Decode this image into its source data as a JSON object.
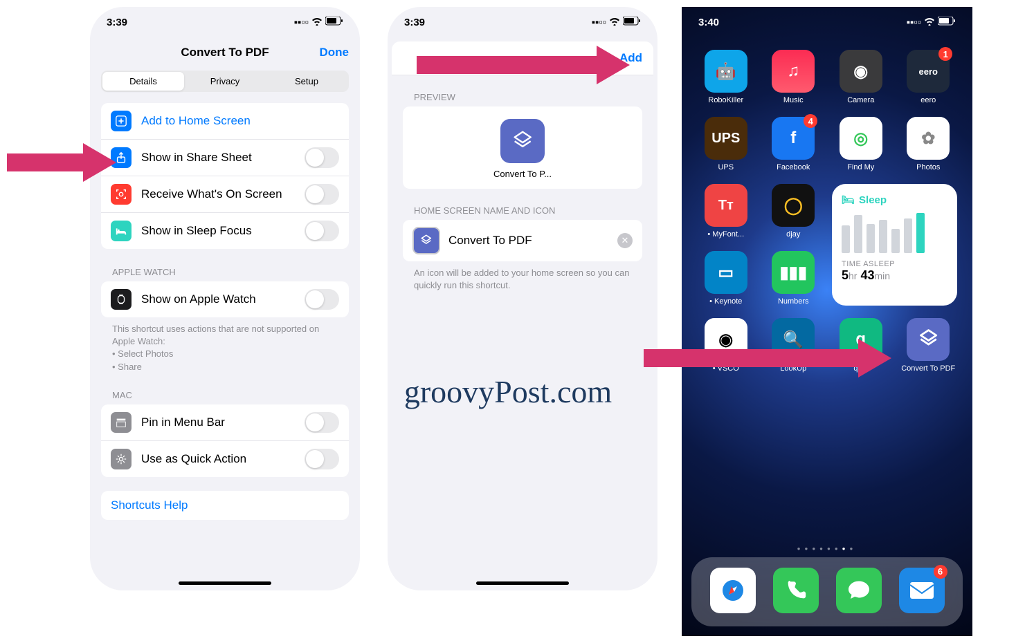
{
  "watermark": "groovyPost.com",
  "phone1": {
    "time": "3:39",
    "title": "Convert To PDF",
    "done": "Done",
    "tabs": [
      "Details",
      "Privacy",
      "Setup"
    ],
    "rows": {
      "addhome": "Add to Home Screen",
      "share": "Show in Share Sheet",
      "receive": "Receive What's On Screen",
      "sleep": "Show in Sleep Focus"
    },
    "watchHeader": "APPLE WATCH",
    "watchRow": "Show on Apple Watch",
    "watchNote": "This shortcut uses actions that are not supported on Apple Watch:\n• Select Photos\n• Share",
    "macHeader": "MAC",
    "pin": "Pin in Menu Bar",
    "quick": "Use as Quick Action",
    "help": "Shortcuts Help"
  },
  "phone2": {
    "time": "3:39",
    "add": "Add",
    "previewHeader": "PREVIEW",
    "previewLabel": "Convert To P...",
    "nameHeader": "HOME SCREEN NAME AND ICON",
    "nameValue": "Convert To PDF",
    "nameNote": "An icon will be added to your home screen so you can quickly run this shortcut."
  },
  "phone3": {
    "time": "3:40",
    "apps": [
      {
        "name": "RoboKiller",
        "bg": "#0ea5e9",
        "icon": "🤖"
      },
      {
        "name": "Music",
        "bg": "linear-gradient(#fb2c53,#ff5a6e)",
        "icon": "♫"
      },
      {
        "name": "Camera",
        "bg": "#3a3a3c",
        "icon": "◉"
      },
      {
        "name": "eero",
        "bg": "#1e293b",
        "icon": "eero",
        "badge": "1",
        "text": true
      },
      {
        "name": "UPS",
        "bg": "#4a2c0a",
        "icon": "UPS",
        "text": true
      },
      {
        "name": "Facebook",
        "bg": "#1877f2",
        "icon": "f",
        "badge": "4"
      },
      {
        "name": "Find My",
        "bg": "#fff",
        "icon": "◎",
        "fg": "#34c759"
      },
      {
        "name": "Photos",
        "bg": "#fff",
        "icon": "✿",
        "fg": "#888"
      },
      {
        "name": "MyFont...",
        "bg": "#ef4444",
        "icon": "Tт",
        "dot": true,
        "text": true
      },
      {
        "name": "djay",
        "bg": "#111",
        "icon": "◯",
        "fg": "#fbbf24"
      },
      {
        "name": "Keynote",
        "bg": "#0284c7",
        "icon": "▭",
        "dot": true
      },
      {
        "name": "Numbers",
        "bg": "#22c55e",
        "icon": "▮▮▮"
      },
      {
        "name": "VSCO",
        "bg": "#fff",
        "icon": "◉",
        "fg": "#000",
        "dot": true
      },
      {
        "name": "LookUp",
        "bg": "#0369a1",
        "icon": "🔍"
      },
      {
        "name": "quip",
        "bg": "#10b981",
        "icon": "q"
      },
      {
        "name": "Convert To PDF",
        "bg": "#5a6ac4",
        "icon": "shortcut"
      }
    ],
    "widget": {
      "title": "Sleep",
      "label": "TIME ASLEEP",
      "hours": "5",
      "mins": "43",
      "appLabel": "Sleep"
    },
    "dock": [
      {
        "name": "safari",
        "bg": "#fff"
      },
      {
        "name": "phone",
        "bg": "#34c759"
      },
      {
        "name": "messages",
        "bg": "#34c759"
      },
      {
        "name": "mail",
        "bg": "#1e88e5",
        "badge": "6"
      }
    ]
  }
}
